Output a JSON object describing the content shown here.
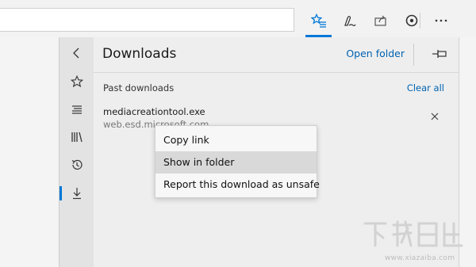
{
  "toolbar": {
    "buttons": [
      {
        "name": "hub-favorites-icon"
      },
      {
        "name": "web-note-icon"
      },
      {
        "name": "share-icon"
      },
      {
        "name": "cortana-icon"
      },
      {
        "name": "more-icon"
      }
    ]
  },
  "hub": {
    "rail": {
      "items": [
        "back-icon",
        "favorites-star-icon",
        "reading-list-icon",
        "books-icon",
        "history-icon",
        "downloads-icon"
      ],
      "active": "downloads-icon"
    }
  },
  "panel": {
    "title": "Downloads",
    "open_folder_label": "Open folder",
    "section_label": "Past downloads",
    "clear_all_label": "Clear all",
    "downloads": [
      {
        "file_name": "mediacreationtool.exe",
        "source": "web.esd.microsoft.com"
      }
    ]
  },
  "context_menu": {
    "items": [
      {
        "label": "Copy link"
      },
      {
        "label": "Show in folder",
        "hovered": true
      },
      {
        "label": "Report this download as unsafe"
      }
    ]
  },
  "watermark": {
    "url": "www.xiazaiba.com"
  },
  "colors": {
    "accent": "#0078d7",
    "link": "#0063b1",
    "panel_bg": "#eeeeee",
    "rail_bg": "#e3e3e3"
  }
}
